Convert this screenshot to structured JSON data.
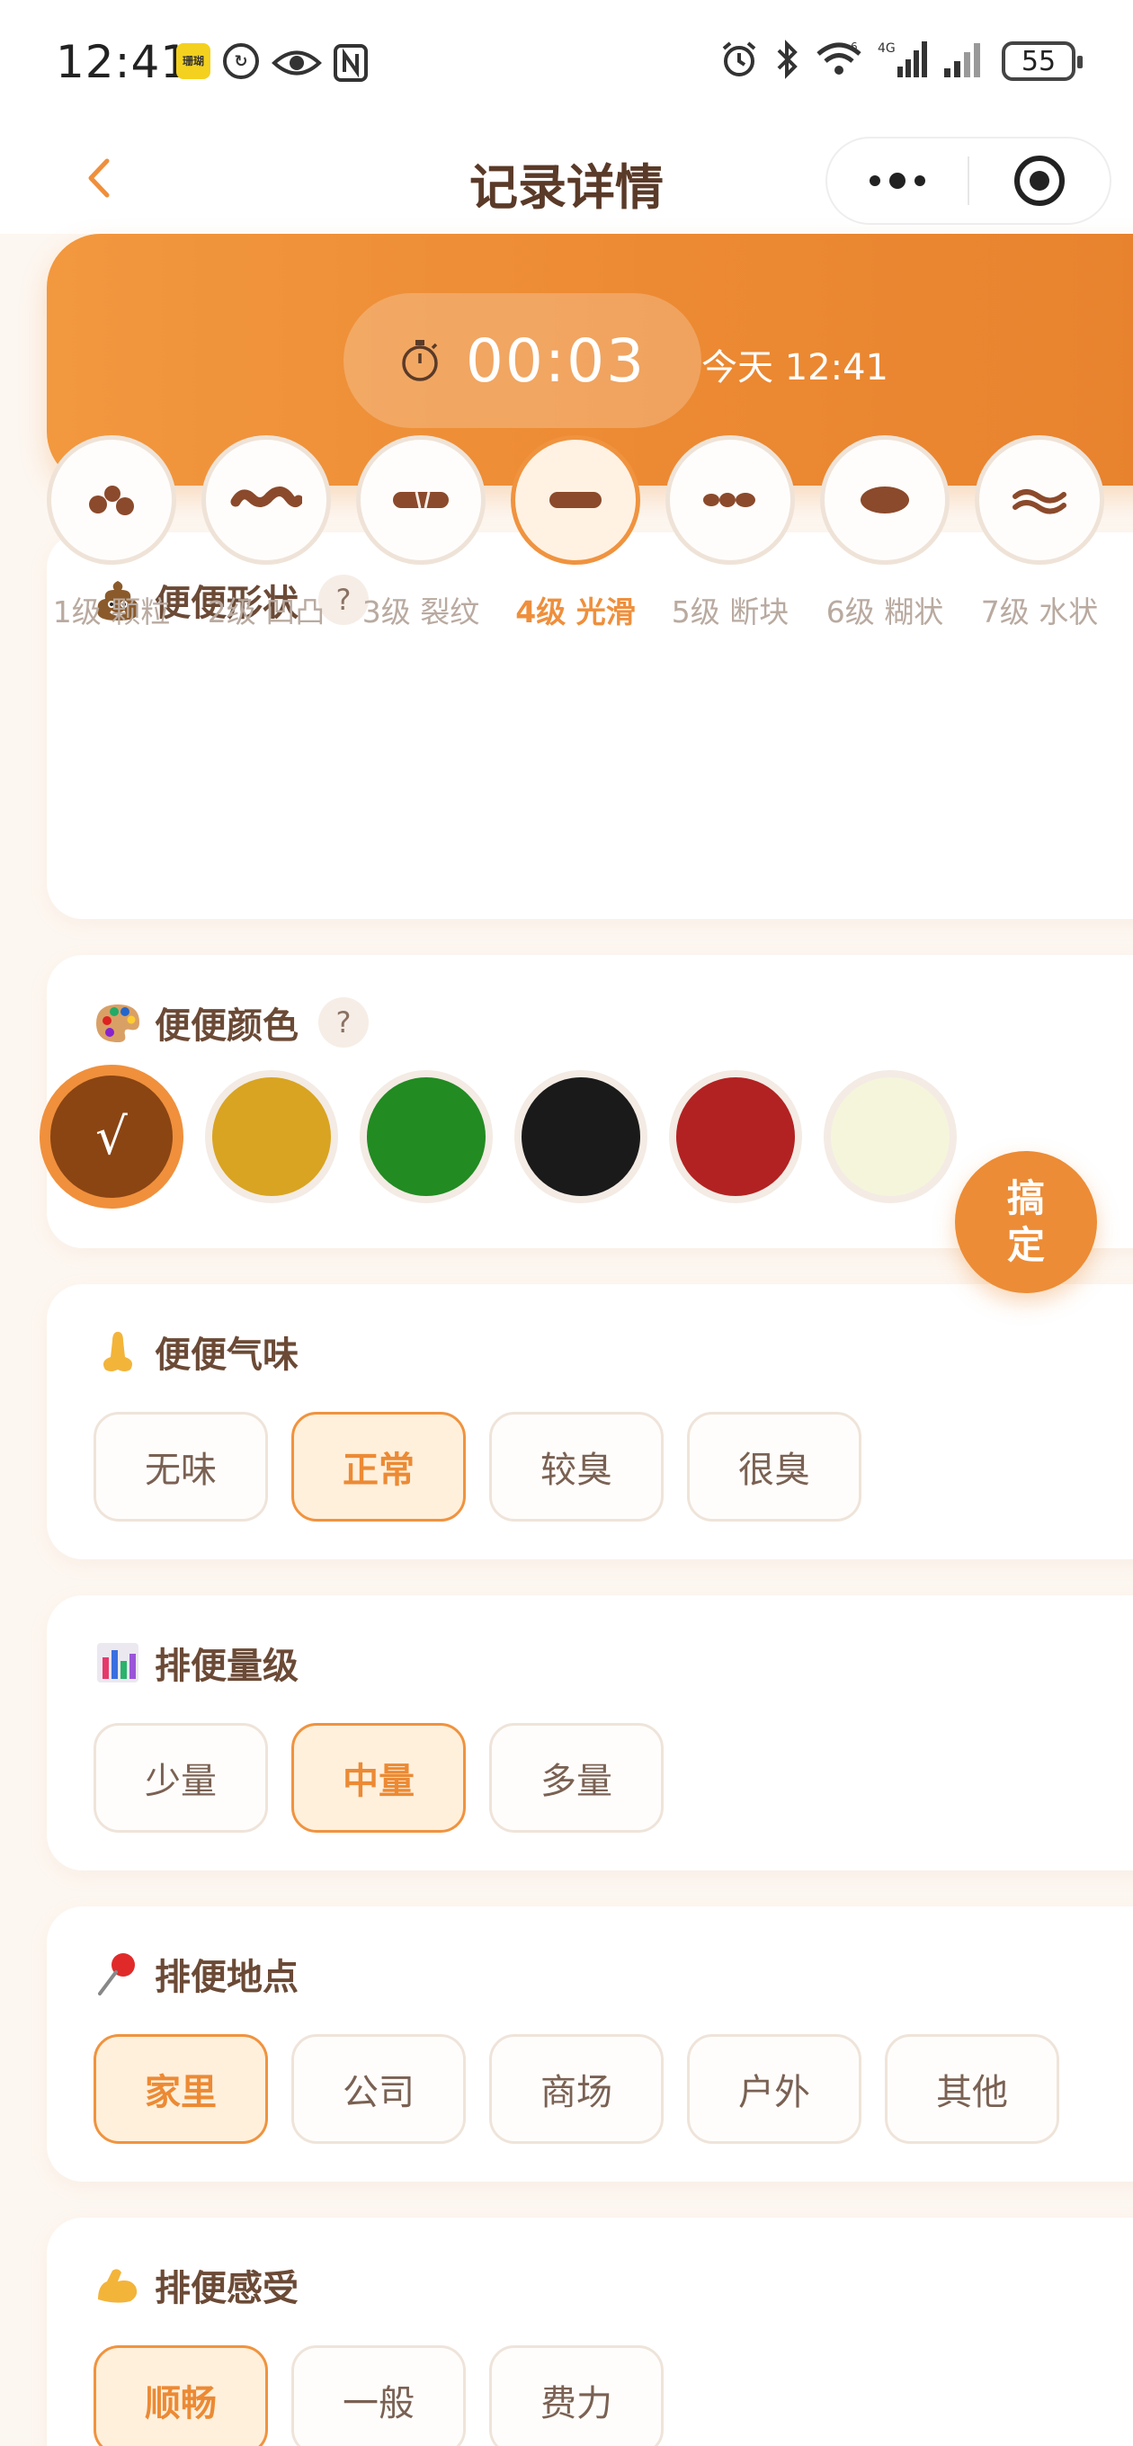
{
  "status_bar": {
    "time": "12:41",
    "app_badge": "珊瑚",
    "battery": "55",
    "network": "4G",
    "wifi_label": "6"
  },
  "nav": {
    "title": "记录详情",
    "back_icon": "chevron-left-icon",
    "more_icon": "more-dots-icon",
    "close_icon": "target-icon"
  },
  "timer": {
    "value": "00:03",
    "date": "今天 12:41",
    "icon": "stopwatch-icon"
  },
  "shape_section": {
    "title": "便便形状",
    "help": "?",
    "icon": "poop-icon",
    "options": [
      {
        "label": "1级 颗粒",
        "selected": false
      },
      {
        "label": "2级 凹凸",
        "selected": false
      },
      {
        "label": "3级 裂纹",
        "selected": false
      },
      {
        "label": "4级 光滑",
        "selected": true
      },
      {
        "label": "5级 断块",
        "selected": false
      },
      {
        "label": "6级 糊状",
        "selected": false
      },
      {
        "label": "7级 水状",
        "selected": false
      }
    ]
  },
  "color_section": {
    "title": "便便颜色",
    "help": "?",
    "icon": "palette-icon",
    "check": "√",
    "options": [
      {
        "color": "#8b4513",
        "selected": true
      },
      {
        "color": "#d9a421",
        "selected": false
      },
      {
        "color": "#228b22",
        "selected": false
      },
      {
        "color": "#1a1a1a",
        "selected": false
      },
      {
        "color": "#b22222",
        "selected": false
      },
      {
        "color": "#f5f5dc",
        "selected": false
      }
    ]
  },
  "fab": {
    "line1": "搞",
    "line2": "定"
  },
  "smell_section": {
    "title": "便便气味",
    "icon": "nose-icon",
    "options": [
      {
        "label": "无味",
        "selected": false
      },
      {
        "label": "正常",
        "selected": true
      },
      {
        "label": "较臭",
        "selected": false
      },
      {
        "label": "很臭",
        "selected": false
      }
    ]
  },
  "amount_section": {
    "title": "排便量级",
    "icon": "bar-chart-icon",
    "options": [
      {
        "label": "少量",
        "selected": false
      },
      {
        "label": "中量",
        "selected": true
      },
      {
        "label": "多量",
        "selected": false
      }
    ]
  },
  "location_section": {
    "title": "排便地点",
    "icon": "pushpin-icon",
    "options": [
      {
        "label": "家里",
        "selected": true
      },
      {
        "label": "公司",
        "selected": false
      },
      {
        "label": "商场",
        "selected": false
      },
      {
        "label": "户外",
        "selected": false
      },
      {
        "label": "其他",
        "selected": false
      }
    ]
  },
  "feeling_section": {
    "title": "排便感受",
    "icon": "flexed-biceps-icon",
    "options": [
      {
        "label": "顺畅",
        "selected": true
      },
      {
        "label": "一般",
        "selected": false
      },
      {
        "label": "费力",
        "selected": false
      }
    ]
  }
}
